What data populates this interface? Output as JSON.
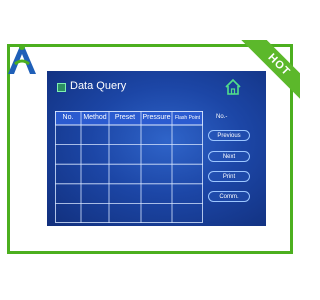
{
  "screen": {
    "title": "Data Query",
    "table": {
      "columns": [
        "No.",
        "Method",
        "Preset",
        "Pressure",
        "Flash Point"
      ],
      "rows": 5
    },
    "no_label": "No.-",
    "buttons": {
      "previous": "Previous",
      "next": "Next",
      "print": "Print",
      "comm": "Comm."
    }
  },
  "badge": {
    "hot": "HOT"
  },
  "colors": {
    "frame_green": "#4caf1f",
    "screen_blue": "#1c46a6",
    "home_icon": "#52e08a"
  },
  "icons": [
    "brand-logo-icon",
    "database-icon",
    "home-icon"
  ]
}
